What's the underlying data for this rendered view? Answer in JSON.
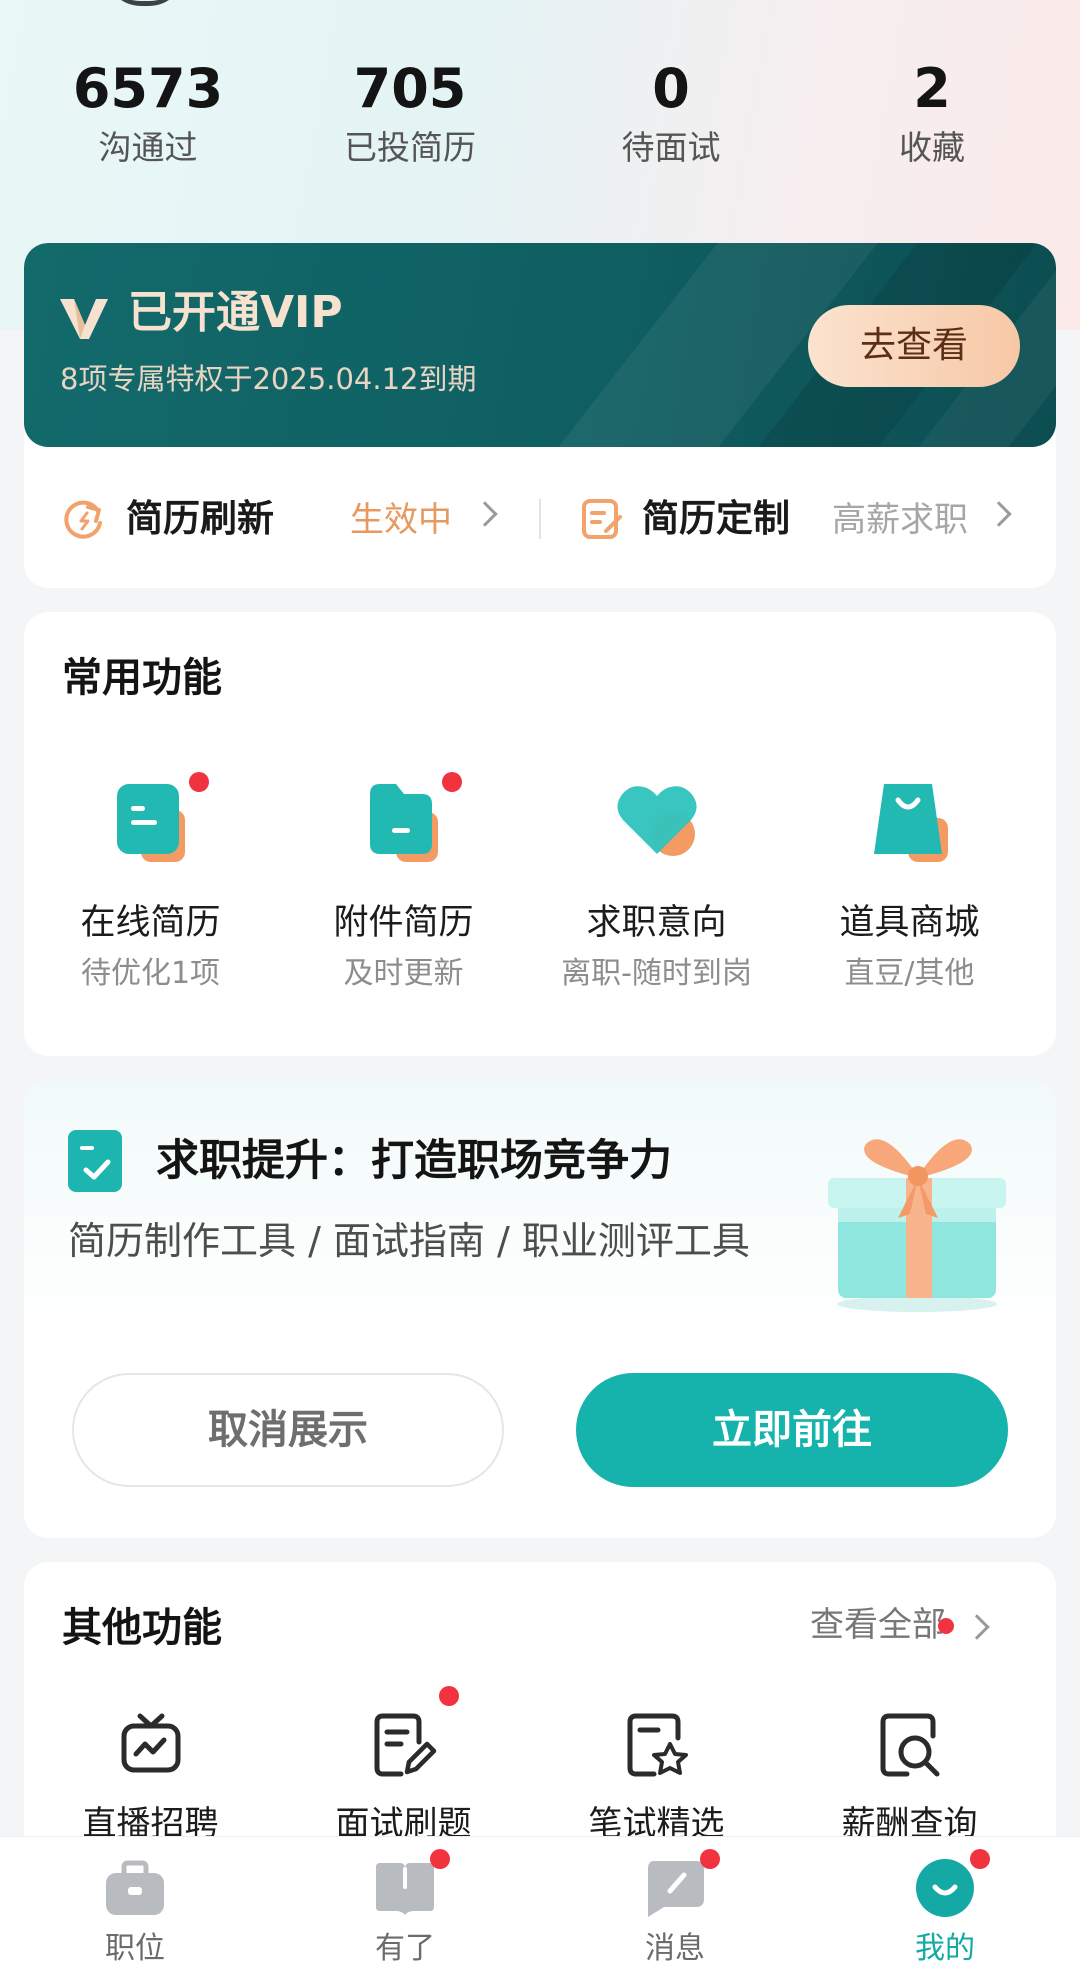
{
  "stats": [
    {
      "value": "6573",
      "label": "沟通过"
    },
    {
      "value": "705",
      "label": "已投简历"
    },
    {
      "value": "0",
      "label": "待面试"
    },
    {
      "value": "2",
      "label": "收藏"
    }
  ],
  "vip": {
    "title": "已开通VIP",
    "subtitle": "8项专属特权于2025.04.12到期",
    "button": "去查看",
    "items": [
      {
        "label": "简历刷新",
        "value": "生效中",
        "icon": "refresh-icon"
      },
      {
        "label": "简历定制",
        "value": "高薪求职",
        "icon": "edit-doc-icon"
      }
    ]
  },
  "common": {
    "title": "常用功能",
    "items": [
      {
        "name": "在线简历",
        "desc": "待优化1项",
        "icon": "online-resume-icon",
        "dot": true
      },
      {
        "name": "附件简历",
        "desc": "及时更新",
        "icon": "folder-resume-icon",
        "dot": true
      },
      {
        "name": "求职意向",
        "desc": "离职-随时到岗",
        "icon": "heart-icon",
        "dot": false
      },
      {
        "name": "道具商城",
        "desc": "直豆/其他",
        "icon": "shopping-bag-icon",
        "dot": false
      }
    ]
  },
  "promo": {
    "title": "求职提升：打造职场竞争力",
    "subtitle": "简历制作工具 / 面试指南 / 职业测评工具",
    "cancel": "取消展示",
    "go": "立即前往",
    "image": "gift-box-icon"
  },
  "other": {
    "title": "其他功能",
    "see_all": "查看全部",
    "items": [
      {
        "name": "直播招聘",
        "icon": "tv-live-icon",
        "dot": false
      },
      {
        "name": "面试刷题",
        "icon": "doc-pen-icon",
        "dot": true
      },
      {
        "name": "笔试精选",
        "icon": "star-doc-icon",
        "dot": false
      },
      {
        "name": "薪酬查询",
        "icon": "search-doc-icon",
        "dot": false
      }
    ]
  },
  "nav": [
    {
      "label": "职位",
      "icon": "briefcase-icon",
      "dot": false,
      "active": false
    },
    {
      "label": "有了",
      "icon": "book-icon",
      "dot": true,
      "active": false
    },
    {
      "label": "消息",
      "icon": "chat-icon",
      "dot": true,
      "active": false
    },
    {
      "label": "我的",
      "icon": "profile-smile-icon",
      "dot": true,
      "active": true
    }
  ],
  "colors": {
    "accent": "#16b3ad",
    "vip_bg": "#0f5f62",
    "vip_gold": "#f6e2cf",
    "badge_red": "#f0333f",
    "orange": "#f2a26b"
  }
}
